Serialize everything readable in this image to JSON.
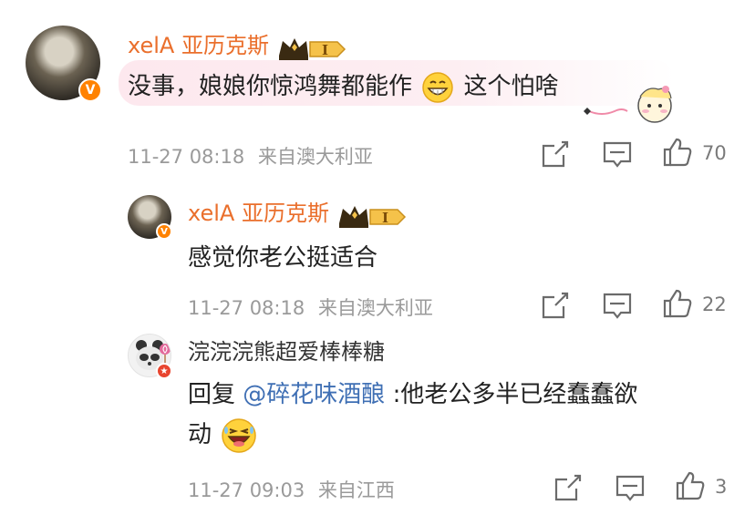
{
  "comment1": {
    "username": "xelA 亚历克斯",
    "level_badge": "I",
    "text": "没事，娘娘你惊鸿舞都能作",
    "text_after_emoji": "这个怕啥",
    "emoji": "grin-emoji",
    "time": "11-27 08:18",
    "location": "来自澳大利亚",
    "likes": "70"
  },
  "reply1": {
    "username": "xelA 亚历克斯",
    "level_badge": "I",
    "text": "感觉你老公挺适合",
    "time": "11-27 08:18",
    "location": "来自澳大利亚",
    "likes": "22"
  },
  "reply2": {
    "username": "浣浣浣熊超爱棒棒糖",
    "reply_prefix": "回复",
    "mention": "@碎花味酒酿",
    "text": ":他老公多半已经蠢蠢欲",
    "text_line2": "动",
    "emoji": "laughing-emoji",
    "time": "11-27 09:03",
    "location": "来自江西",
    "likes": "3"
  },
  "colors": {
    "username": "#ea6f2c",
    "verified_badge": "#ff8200",
    "mention": "#3f6fb4",
    "meta": "#9a9a9a"
  },
  "icons": [
    "share-icon",
    "comment-icon",
    "like-icon",
    "crown-level-icon",
    "verified-v-icon"
  ]
}
